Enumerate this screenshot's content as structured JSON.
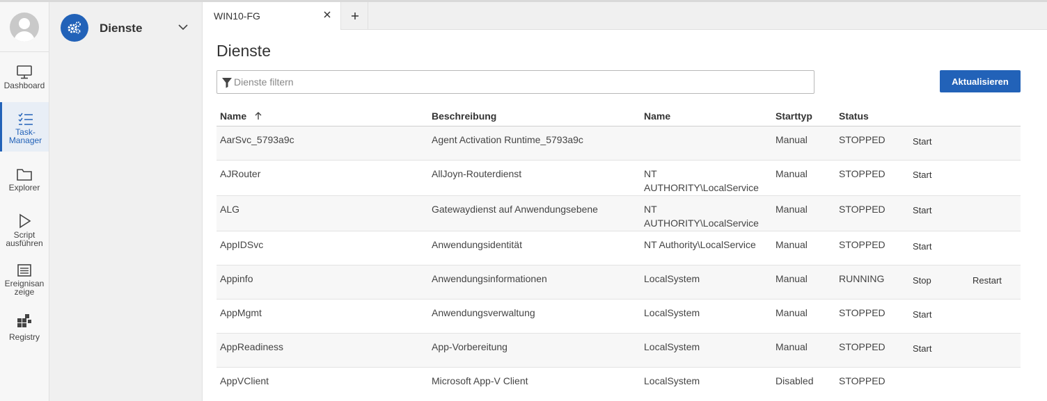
{
  "rail": {
    "items": [
      {
        "label": "Dashboard",
        "icon": "monitor-icon"
      },
      {
        "label": "Task-\nManager",
        "icon": "checklist-icon",
        "active": true
      },
      {
        "label": "Explorer",
        "icon": "folder-icon"
      },
      {
        "label": "Script\nausführen",
        "icon": "play-icon"
      },
      {
        "label": "Ereignisan\nzeige",
        "icon": "event-list-icon"
      },
      {
        "label": "Registry",
        "icon": "registry-icon"
      }
    ]
  },
  "subbar": {
    "title": "Dienste",
    "icon": "gears-icon"
  },
  "tabs": {
    "active_label": "WIN10-FG"
  },
  "main": {
    "title": "Dienste",
    "filter_placeholder": "Dienste filtern",
    "refresh_label": "Aktualisieren"
  },
  "table": {
    "headers": {
      "name": "Name",
      "description": "Beschreibung",
      "account": "Name",
      "start_type": "Starttyp",
      "status": "Status"
    },
    "sort_icon": "arrow-up-icon",
    "rows": [
      {
        "name": "AarSvc_5793a9c",
        "description": "Agent Activation Runtime_5793a9c",
        "account": "",
        "start_type": "Manual",
        "status": "STOPPED",
        "action1": "Start",
        "action2": ""
      },
      {
        "name": "AJRouter",
        "description": "AllJoyn-Routerdienst",
        "account": "NT\nAUTHORITY\\LocalService",
        "start_type": "Manual",
        "status": "STOPPED",
        "action1": "Start",
        "action2": ""
      },
      {
        "name": "ALG",
        "description": "Gatewaydienst auf Anwendungsebene",
        "account": "NT\nAUTHORITY\\LocalService",
        "start_type": "Manual",
        "status": "STOPPED",
        "action1": "Start",
        "action2": ""
      },
      {
        "name": "AppIDSvc",
        "description": "Anwendungsidentität",
        "account": "NT Authority\\LocalService",
        "start_type": "Manual",
        "status": "STOPPED",
        "action1": "Start",
        "action2": ""
      },
      {
        "name": "Appinfo",
        "description": "Anwendungsinformationen",
        "account": "LocalSystem",
        "start_type": "Manual",
        "status": "RUNNING",
        "action1": "Stop",
        "action2": "Restart"
      },
      {
        "name": "AppMgmt",
        "description": "Anwendungsverwaltung",
        "account": "LocalSystem",
        "start_type": "Manual",
        "status": "STOPPED",
        "action1": "Start",
        "action2": ""
      },
      {
        "name": "AppReadiness",
        "description": "App-Vorbereitung",
        "account": "LocalSystem",
        "start_type": "Manual",
        "status": "STOPPED",
        "action1": "Start",
        "action2": ""
      },
      {
        "name": "AppVClient",
        "description": "Microsoft App-V Client",
        "account": "LocalSystem",
        "start_type": "Disabled",
        "status": "STOPPED",
        "action1": "",
        "action2": ""
      }
    ]
  },
  "colors": {
    "accent": "#2262b8",
    "sidebar_bg": "#f0f0f0",
    "rail_bg": "#f7f7f7"
  }
}
